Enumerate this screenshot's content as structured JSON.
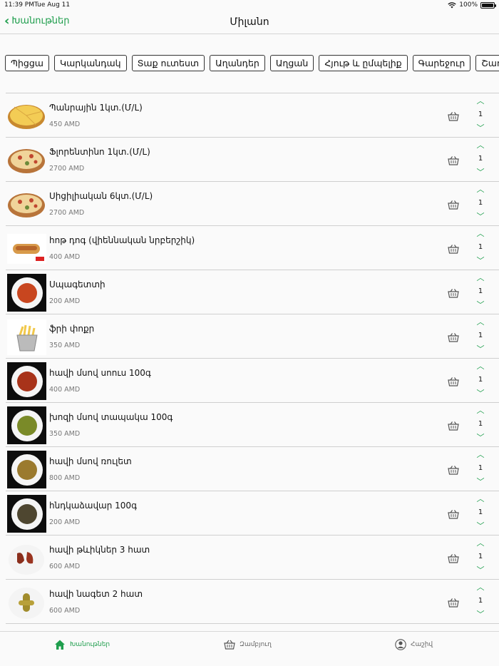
{
  "status": {
    "time": "11:39 PM",
    "date": "Tue Aug 11",
    "battery": "100%"
  },
  "nav": {
    "back_label": "Խանութներ",
    "title": "Միլանո"
  },
  "categories": [
    "Պիցցա",
    "Կարկանդակ",
    "Տաք ուտեստ",
    "Աղանդեր",
    "Աղցան",
    "Հյութ և ըմպելիք",
    "Գարեջուր",
    "Շաուրմա"
  ],
  "products": [
    {
      "name": "Պանրային 1կտ.(Մ/L)",
      "price": "450 AMD",
      "qty": "1",
      "icon": "pizza-slice-icon"
    },
    {
      "name": "Ֆլորենտինո 1կտ.(Մ/L)",
      "price": "2700 AMD",
      "qty": "1",
      "icon": "pizza-icon"
    },
    {
      "name": "Սիցիլիական 6կտ.(Մ/L)",
      "price": "2700 AMD",
      "qty": "1",
      "icon": "pizza-icon"
    },
    {
      "name": "հոթ դոգ  (վիեննական նրբերշիկ)",
      "price": "400 AMD",
      "qty": "1",
      "icon": "hot-dog-icon"
    },
    {
      "name": "Սպագետտի",
      "price": "200 AMD",
      "qty": "1",
      "icon": "spaghetti-icon"
    },
    {
      "name": "ֆրի փոքր",
      "price": "350 AMD",
      "qty": "1",
      "icon": "fries-icon"
    },
    {
      "name": "հավի մսով սոուս 100գ",
      "price": "400 AMD",
      "qty": "1",
      "icon": "sauce-icon"
    },
    {
      "name": "խոզի մսով տապակա 100գ",
      "price": "350 AMD",
      "qty": "1",
      "icon": "stew-icon"
    },
    {
      "name": "հավի մսով ռուլետ",
      "price": "800 AMD",
      "qty": "1",
      "icon": "roll-icon"
    },
    {
      "name": "հնդկաձավար 100գ",
      "price": "200 AMD",
      "qty": "1",
      "icon": "buckwheat-icon"
    },
    {
      "name": "հավի թևիկներ 3 հատ",
      "price": "600 AMD",
      "qty": "1",
      "icon": "wings-icon"
    },
    {
      "name": "հավի նագետ 2 հատ",
      "price": "600 AMD",
      "qty": "1",
      "icon": "nuggets-icon"
    }
  ],
  "tabs": {
    "shops": "Խանութներ",
    "cart": "Զամբյուղ",
    "account": "Հաշիվ"
  },
  "colors": {
    "accent": "#1f9e4d"
  }
}
